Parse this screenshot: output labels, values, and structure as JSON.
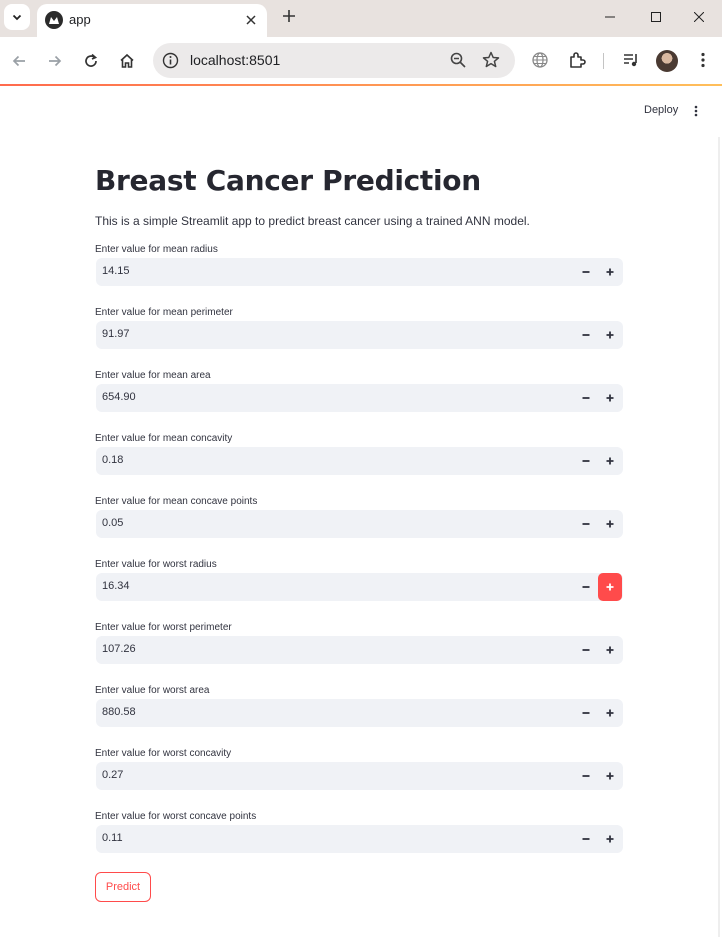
{
  "browser": {
    "tab_title": "app",
    "url": "localhost:8501"
  },
  "streamlit": {
    "deploy_label": "Deploy"
  },
  "app": {
    "title": "Breast Cancer Prediction",
    "description": "This is a simple Streamlit app to predict breast cancer using a trained ANN model.",
    "fields": [
      {
        "label": "Enter value for mean radius",
        "value": "14.15"
      },
      {
        "label": "Enter value for mean perimeter",
        "value": "91.97"
      },
      {
        "label": "Enter value for mean area",
        "value": "654.90"
      },
      {
        "label": "Enter value for mean concavity",
        "value": "0.18"
      },
      {
        "label": "Enter value for mean concave points",
        "value": "0.05"
      },
      {
        "label": "Enter value for worst radius",
        "value": "16.34"
      },
      {
        "label": "Enter value for worst perimeter",
        "value": "107.26"
      },
      {
        "label": "Enter value for worst area",
        "value": "880.58"
      },
      {
        "label": "Enter value for worst concavity",
        "value": "0.27"
      },
      {
        "label": "Enter value for worst concave points",
        "value": "0.11"
      }
    ],
    "predict_label": "Predict"
  },
  "colors": {
    "accent": "#ff4b4b",
    "input_bg": "#f0f2f6",
    "text": "#31333f"
  }
}
